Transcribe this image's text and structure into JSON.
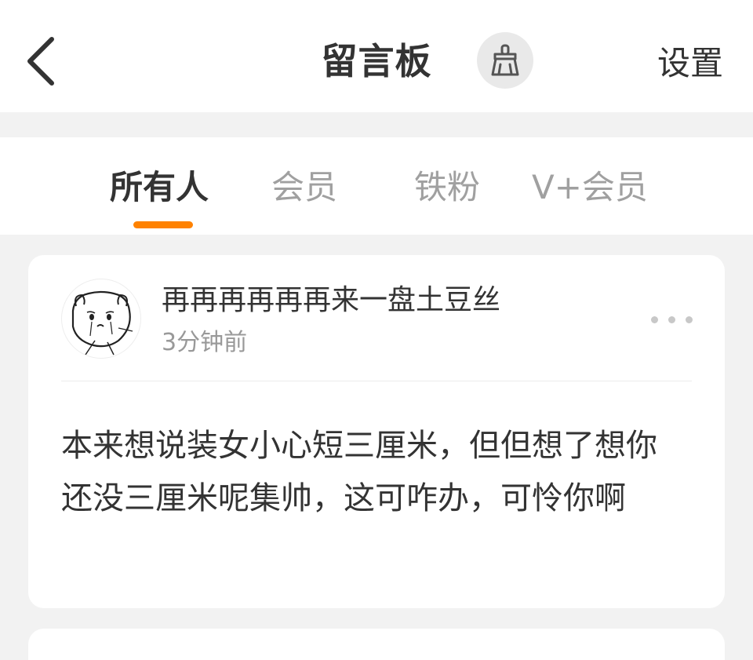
{
  "header": {
    "title": "留言板",
    "settings_label": "设置",
    "back_icon": "chevron-left-icon",
    "clean_icon": "broom-icon"
  },
  "tabs": [
    {
      "label": "所有人",
      "active": true
    },
    {
      "label": "会员",
      "active": false
    },
    {
      "label": "铁粉",
      "active": false
    },
    {
      "label": "V+会员",
      "active": false
    }
  ],
  "colors": {
    "accent": "#ff8200",
    "text_primary": "#333333",
    "text_secondary": "#999999",
    "tab_inactive": "#a0a0a0",
    "background": "#f2f2f2"
  },
  "messages": [
    {
      "username": "再再再再再再来一盘土豆丝",
      "time": "3分钟前",
      "avatar_icon": "sad-cat-avatar",
      "more_icon": "more-dots-icon",
      "content": "本来想说装女小心短三厘米，但但想了想你还没三厘米呢集帅，这可咋办，可怜你啊"
    }
  ]
}
